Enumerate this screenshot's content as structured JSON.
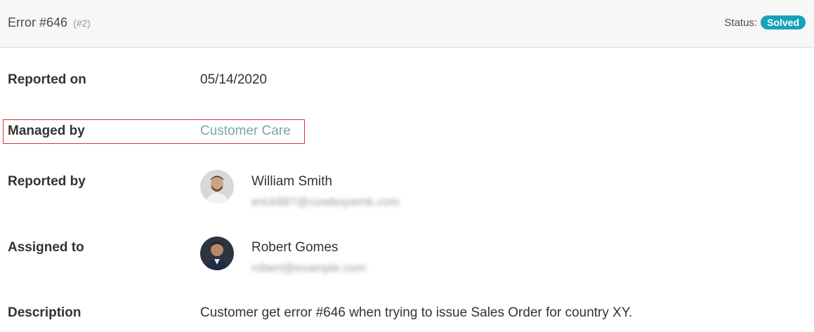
{
  "header": {
    "title": "Error #646",
    "ref": "(#2)",
    "status_label": "Status:",
    "status_value": "Solved",
    "status_color": "#17a2b8"
  },
  "fields": {
    "reported_on": {
      "label": "Reported on",
      "value": "05/14/2020"
    },
    "managed_by": {
      "label": "Managed by",
      "value": "Customer Care"
    },
    "reported_by": {
      "label": "Reported by",
      "name": "William Smith",
      "email": "erick887@cowboywmk.com",
      "avatar_icon": "user-avatar-icon"
    },
    "assigned_to": {
      "label": "Assigned to",
      "name": "Robert Gomes",
      "email": "robert@example.com",
      "avatar_icon": "user-avatar-icon"
    },
    "description": {
      "label": "Description",
      "value": "Customer get error #646 when trying to issue Sales Order for country XY."
    }
  },
  "colors": {
    "link": "#7aa9a0",
    "highlight_border": "#d9363e"
  }
}
